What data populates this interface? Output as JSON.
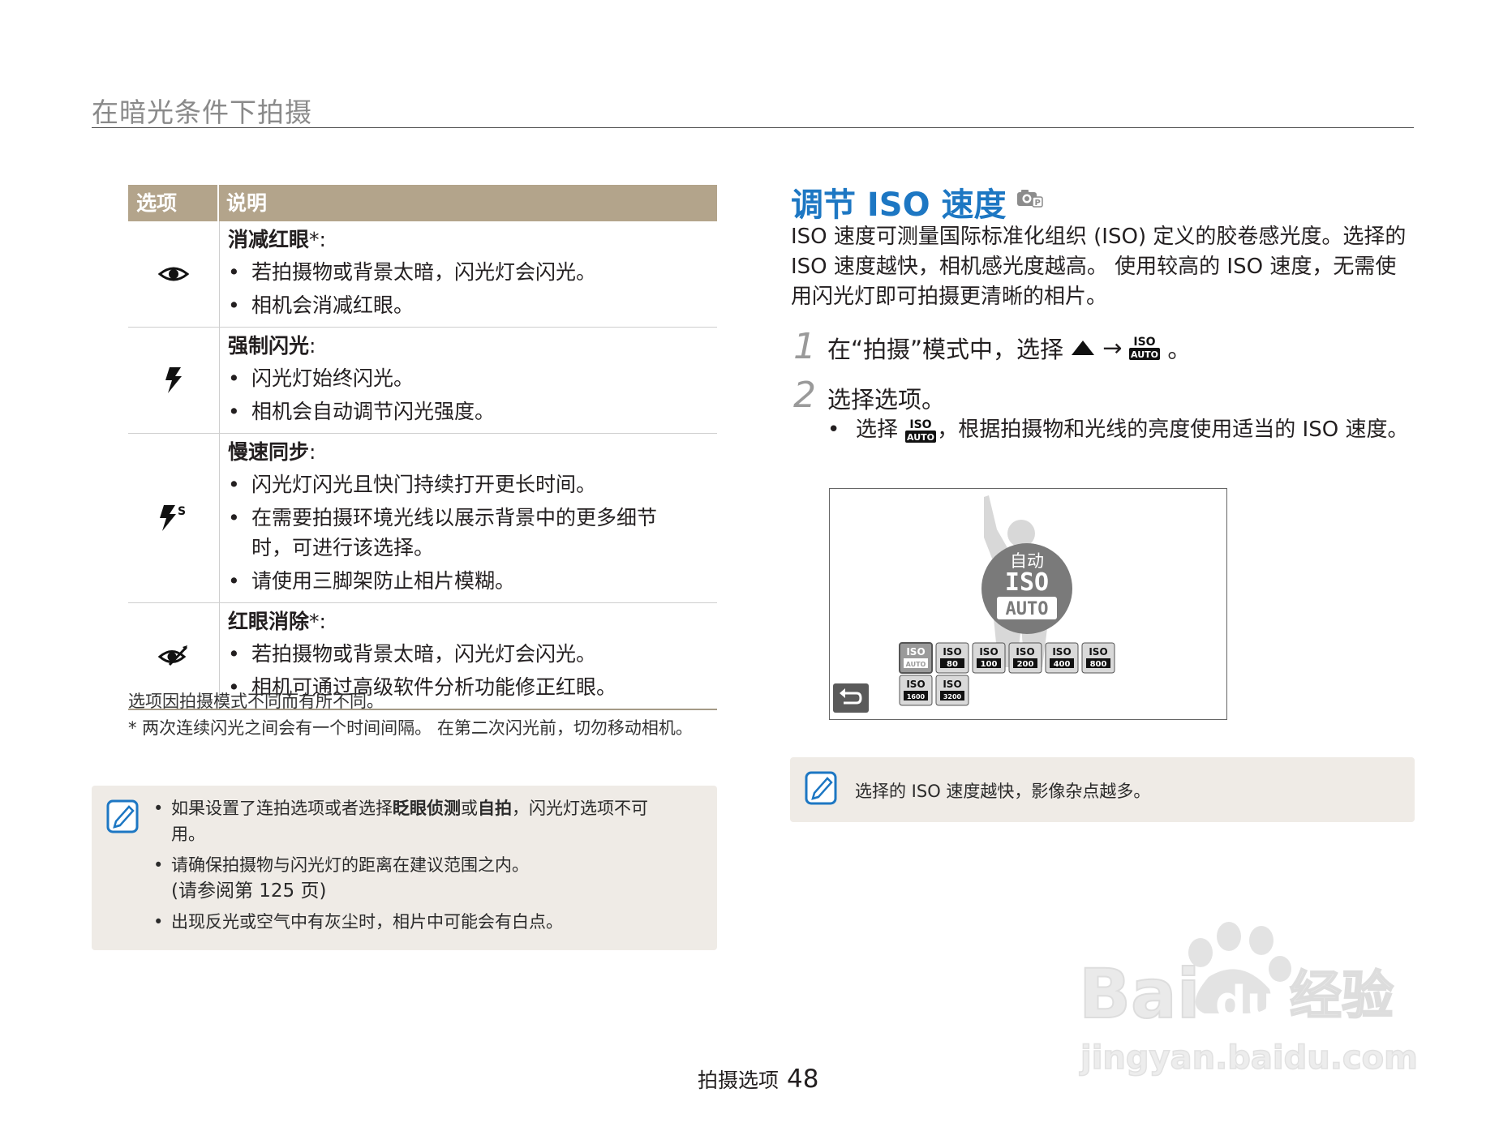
{
  "header": {
    "section_title": "在暗光条件下拍摄"
  },
  "flash_table": {
    "col_option": "选项",
    "col_description": "说明",
    "rows": [
      {
        "icon": "red-eye-eye-icon",
        "name": "消减红眼",
        "star": "*:",
        "items": [
          "若拍摄物或背景太暗，闪光灯会闪光。",
          "相机会消减红眼。"
        ]
      },
      {
        "icon": "flash-bolt-icon",
        "name": "强制闪光",
        "star": ":",
        "items": [
          "闪光灯始终闪光。",
          "相机会自动调节闪光强度。"
        ]
      },
      {
        "icon": "slow-sync-flash-icon",
        "name": "慢速同步",
        "star": ":",
        "items": [
          "闪光灯闪光且快门持续打开更长时间。",
          "在需要拍摄环境光线以展示背景中的更多细节时，可进行该选择。",
          "请使用三脚架防止相片模糊。"
        ]
      },
      {
        "icon": "red-eye-fix-icon",
        "name": "红眼消除",
        "star": "*:",
        "items": [
          "若拍摄物或背景太暗，闪光灯会闪光。",
          "相机可通过高级软件分析功能修正红眼。"
        ]
      }
    ]
  },
  "footnotes": {
    "line1": "选项因拍摄模式不同而有所不同。",
    "line2": "* 两次连续闪光之间会有一个时间间隔。 在第二次闪光前，切勿移动相机。"
  },
  "note_left": {
    "item1_pre": "如果设置了连拍选项或者选择",
    "item1_b1": "眨眼侦测",
    "item1_mid": "或",
    "item1_b2": "自拍",
    "item1_post": "，闪光灯选项不可用。",
    "item2": "请确保拍摄物与闪光灯的距离在建议范围之内。",
    "item2_ref": "(请参阅第 125 页)",
    "item3": "出现反光或空气中有灰尘时，相片中可能会有白点。"
  },
  "iso_section": {
    "title": "调节 ISO 速度",
    "intro": "ISO 速度可测量国际标准化组织 (ISO) 定义的胶卷感光度。选择的 ISO 速度越快，相机感光度越高。 使用较高的 ISO 速度，无需使用闪光灯即可拍摄更清晰的相片。",
    "step1_num": "1",
    "step1_pre": "在“拍摄”模式中，选择",
    "step1_arrow": "→",
    "step1_end": "。",
    "step2_num": "2",
    "step2": "选择选项。",
    "step2_bullet_pre": "选择",
    "step2_bullet_post": "，根据拍摄物和光线的亮度使用适当的 ISO 速度。"
  },
  "camera_screen": {
    "auto_label": "自动",
    "iso_top": "ISO",
    "iso_auto": "AUTO",
    "options": [
      {
        "top": "ISO",
        "bottom": "AUTO",
        "selected": true
      },
      {
        "top": "ISO",
        "bottom": "80"
      },
      {
        "top": "ISO",
        "bottom": "100"
      },
      {
        "top": "ISO",
        "bottom": "200"
      },
      {
        "top": "ISO",
        "bottom": "400"
      },
      {
        "top": "ISO",
        "bottom": "800"
      },
      {
        "top": "ISO",
        "bottom": "1600"
      },
      {
        "top": "ISO",
        "bottom": "3200"
      }
    ]
  },
  "note_right": {
    "text": "选择的 ISO 速度越快，影像杂点越多。"
  },
  "footer": {
    "label": "拍摄选项",
    "page": "48"
  },
  "watermark": {
    "brand": "Bai",
    "du": "du",
    "jingyan": "经验",
    "url": "jingyan.baidu.com"
  },
  "colors": {
    "title_blue": "#1d77c3",
    "table_header": "#b3a48b",
    "note_bg": "#efebe6"
  }
}
